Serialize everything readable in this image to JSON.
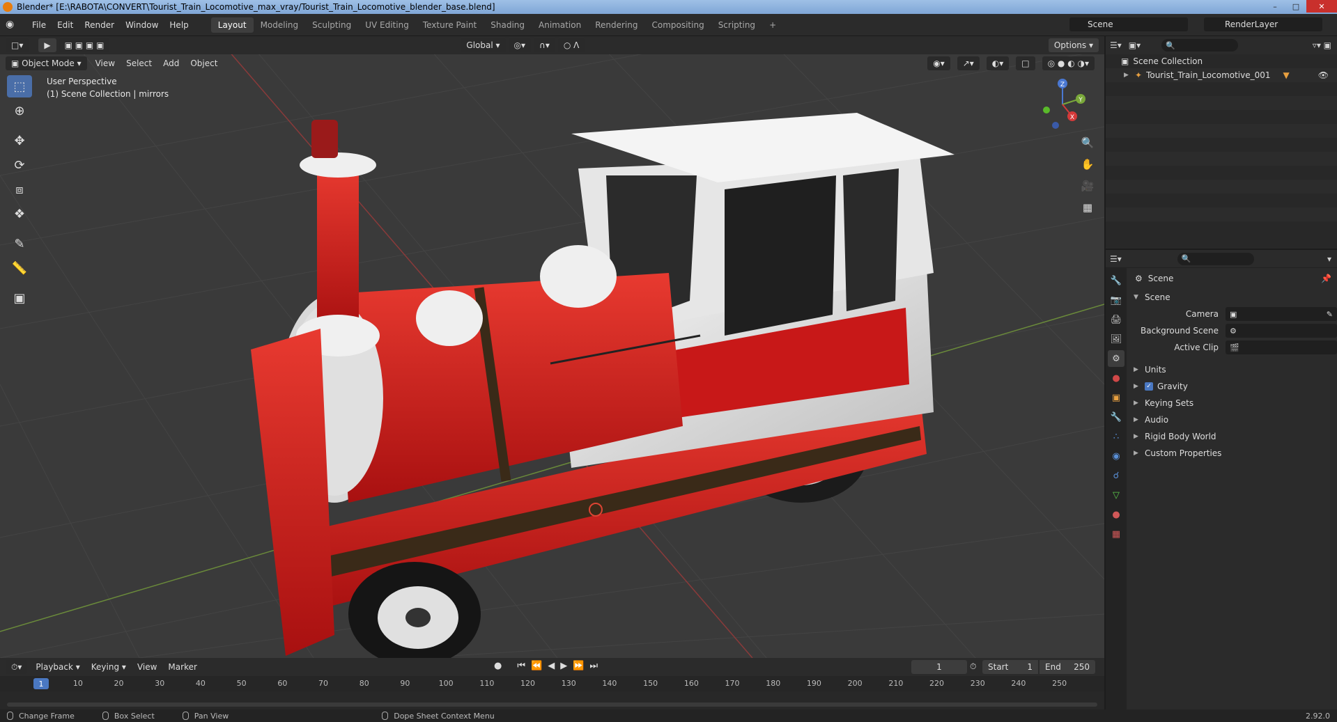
{
  "window": {
    "title": "Blender* [E:\\RABOTA\\CONVERT\\Tourist_Train_Locomotive_max_vray/Tourist_Train_Locomotive_blender_base.blend]"
  },
  "menubar": {
    "items": [
      "File",
      "Edit",
      "Render",
      "Window",
      "Help"
    ]
  },
  "workspaces": {
    "tabs": [
      "Layout",
      "Modeling",
      "Sculpting",
      "UV Editing",
      "Texture Paint",
      "Shading",
      "Animation",
      "Rendering",
      "Compositing",
      "Scripting"
    ],
    "active": "Layout"
  },
  "scene_selector": {
    "value": "Scene"
  },
  "renderlayer_selector": {
    "value": "RenderLayer"
  },
  "viewport_header": {
    "transform_orientation": "Global",
    "options_label": "Options",
    "mode": "Object Mode",
    "menus": [
      "View",
      "Select",
      "Add",
      "Object"
    ]
  },
  "viewport": {
    "perspective_label": "User Perspective",
    "collection_label": "(1) Scene Collection | mirrors"
  },
  "gizmo": {
    "x": "X",
    "y": "Y",
    "z": "Z"
  },
  "outliner": {
    "root": "Scene Collection",
    "items": [
      "Tourist_Train_Locomotive_001"
    ]
  },
  "properties": {
    "context_title": "Scene",
    "panel_scene": "Scene",
    "fields": {
      "camera_label": "Camera",
      "background_label": "Background Scene",
      "active_clip_label": "Active Clip"
    },
    "subpanels": [
      "Units",
      "Gravity",
      "Keying Sets",
      "Audio",
      "Rigid Body World",
      "Custom Properties"
    ],
    "gravity_checked": true
  },
  "timeline": {
    "menus": [
      "Playback",
      "Keying",
      "View",
      "Marker"
    ],
    "current_frame": "1",
    "start_label": "Start",
    "start_value": "1",
    "end_label": "End",
    "end_value": "250",
    "ticks": [
      "1",
      "10",
      "20",
      "30",
      "40",
      "50",
      "60",
      "70",
      "80",
      "90",
      "100",
      "110",
      "120",
      "130",
      "140",
      "150",
      "160",
      "170",
      "180",
      "190",
      "200",
      "210",
      "220",
      "230",
      "240",
      "250"
    ]
  },
  "statusbar": {
    "items": [
      "Change Frame",
      "Box Select",
      "Pan View",
      "Dope Sheet Context Menu"
    ],
    "version": "2.92.0"
  },
  "colors": {
    "accent": "#4a78c2",
    "locomotive_red": "#d42020",
    "locomotive_white": "#ececec"
  }
}
